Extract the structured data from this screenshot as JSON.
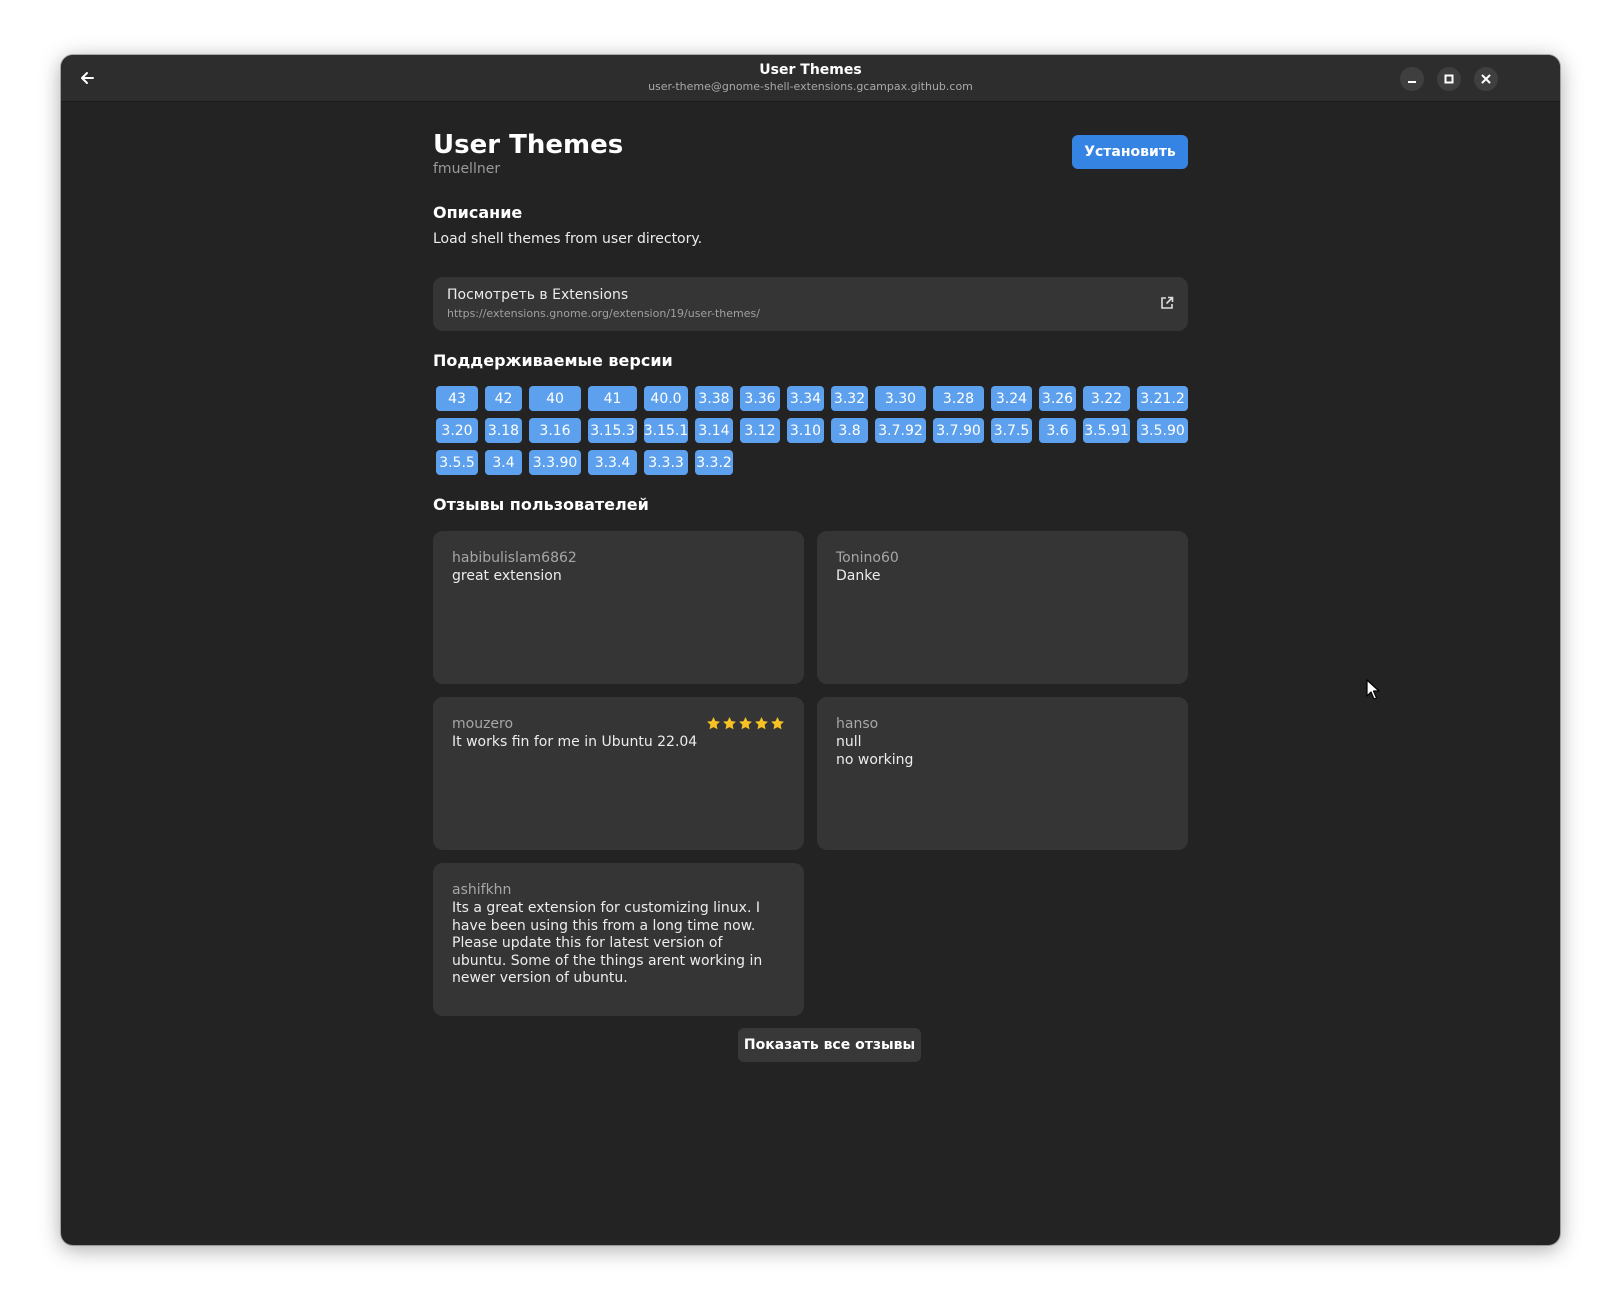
{
  "window": {
    "title": "User Themes",
    "subtitle": "user-theme@gnome-shell-extensions.gcampax.github.com"
  },
  "extension": {
    "name": "User Themes",
    "author": "fmuellner",
    "install_label": "Установить"
  },
  "description": {
    "heading": "Описание",
    "text": "Load shell themes from user directory."
  },
  "link": {
    "title": "Посмотреть в Extensions",
    "url": "https://extensions.gnome.org/extension/19/user-themes/"
  },
  "versions": {
    "heading": "Поддерживаемые версии",
    "items": [
      "43",
      "42",
      "40",
      "41",
      "40.0",
      "3.38",
      "3.36",
      "3.34",
      "3.32",
      "3.30",
      "3.28",
      "3.24",
      "3.26",
      "3.22",
      "3.21.2",
      "3.20",
      "3.18",
      "3.16",
      "3.15.3",
      "3.15.1",
      "3.14",
      "3.12",
      "3.10",
      "3.8",
      "3.7.92",
      "3.7.90",
      "3.7.5",
      "3.6",
      "3.5.91",
      "3.5.90",
      "3.5.5",
      "3.4",
      "3.3.90",
      "3.3.4",
      "3.3.3",
      "3.3.2"
    ]
  },
  "reviews": {
    "heading": "Отзывы пользователей",
    "items": [
      {
        "author": "habibulislam6862",
        "text": "great extension",
        "stars": 0
      },
      {
        "author": "Tonino60",
        "text": "Danke",
        "stars": 0
      },
      {
        "author": "mouzero",
        "text": "It works fin for me in Ubuntu 22.04",
        "stars": 5
      },
      {
        "author": "hanso",
        "text": "null\nno working",
        "stars": 0
      },
      {
        "author": "ashifkhn",
        "text": "Its a great extension for customizing linux. I have been using this from a long time now. Please update this for latest version of ubuntu. Some of the things arent working in newer version of ubuntu.",
        "stars": 0
      }
    ],
    "show_all_label": "Показать все отзывы"
  },
  "colors": {
    "window_bg": "#232323",
    "card_bg": "#353535",
    "accent": "#3584e4",
    "version_chip": "#5da1ee",
    "star": "#f6c223"
  },
  "icons": {
    "back": "arrow-left-icon",
    "minimize": "minimize-icon",
    "maximize": "maximize-icon",
    "close": "close-icon",
    "external_link": "external-link-icon",
    "star": "star-icon",
    "cursor": "mouse-pointer-icon"
  }
}
